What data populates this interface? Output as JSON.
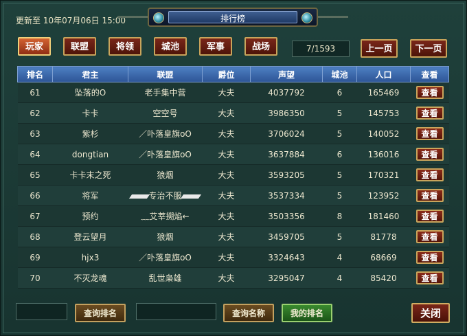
{
  "header": {
    "title": "排行榜",
    "updated_label": "更新至 ",
    "updated_date": "10年07月06日 ",
    "updated_time": "15:00"
  },
  "tabs": [
    "玩家",
    "联盟",
    "将领",
    "城池",
    "军事",
    "战场"
  ],
  "active_tab": "玩家",
  "pager": {
    "page": "7/1593",
    "prev_label": "上一页",
    "next_label": "下一页"
  },
  "table": {
    "headers": [
      "排名",
      "君主",
      "联盟",
      "爵位",
      "声望",
      "城池",
      "人口",
      "查看"
    ],
    "view_label": "查看",
    "rows": [
      {
        "rank": "61",
        "lord": "坠落的O",
        "alliance": "老手集中营",
        "title": "大夫",
        "prestige": "4037792",
        "cities": "6",
        "population": "165469"
      },
      {
        "rank": "62",
        "lord": "卡卡",
        "alliance": "空空号",
        "title": "大夫",
        "prestige": "3986350",
        "cities": "5",
        "population": "145753"
      },
      {
        "rank": "63",
        "lord": "紫杉",
        "alliance": "／卟落皇旗oO",
        "title": "大夫",
        "prestige": "3706024",
        "cities": "5",
        "population": "140052"
      },
      {
        "rank": "64",
        "lord": "dongtian",
        "alliance": "／卟落皇旗oO",
        "title": "大夫",
        "prestige": "3637884",
        "cities": "6",
        "population": "136016"
      },
      {
        "rank": "65",
        "lord": "卡卡末之死",
        "alliance": "狼烟",
        "title": "大夫",
        "prestige": "3593205",
        "cities": "5",
        "population": "170321"
      },
      {
        "rank": "66",
        "lord": "将军",
        "alliance": "专治不服",
        "title": "大夫",
        "prestige": "3537334",
        "cities": "5",
        "population": "123952"
      },
      {
        "rank": "67",
        "lord": "预约",
        "alliance": "﹏艾莘搠焰←",
        "title": "大夫",
        "prestige": "3503356",
        "cities": "8",
        "population": "181460"
      },
      {
        "rank": "68",
        "lord": "登云望月",
        "alliance": "狼烟",
        "title": "大夫",
        "prestige": "3459705",
        "cities": "5",
        "population": "81778"
      },
      {
        "rank": "69",
        "lord": "hjx3",
        "alliance": "／卟落皇旗oO",
        "title": "大夫",
        "prestige": "3324643",
        "cities": "4",
        "population": "68669"
      },
      {
        "rank": "70",
        "lord": "不灭龙魂",
        "alliance": "乱世枭雄",
        "title": "大夫",
        "prestige": "3295047",
        "cities": "4",
        "population": "85420"
      }
    ]
  },
  "footer": {
    "query_rank": "查询排名",
    "query_name": "查询名称",
    "my_rank": "我的排名",
    "close": "关闭"
  },
  "colors": {
    "background": "#1b3632",
    "header_blue": "#3a68ad",
    "button_red": "#6a1f12",
    "button_gold_border": "#c9a45b",
    "my_rank_green": "#2e7a26"
  }
}
